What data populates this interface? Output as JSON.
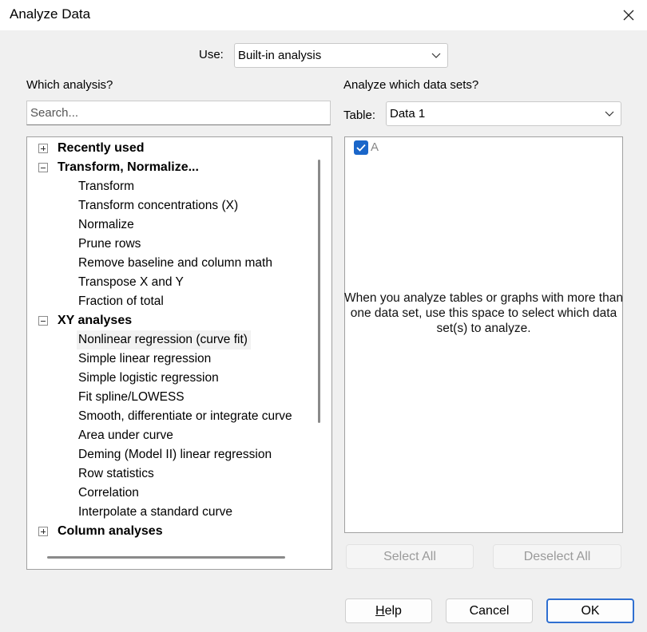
{
  "window": {
    "title": "Analyze Data"
  },
  "use": {
    "label": "Use:",
    "selected": "Built-in analysis"
  },
  "which_analysis": {
    "label": "Which analysis?",
    "search_placeholder": "Search...",
    "tree": [
      {
        "label": "Recently used",
        "expanded": false,
        "children": []
      },
      {
        "label": "Transform, Normalize...",
        "expanded": true,
        "children": [
          "Transform",
          "Transform concentrations (X)",
          "Normalize",
          "Prune rows",
          "Remove baseline and column math",
          "Transpose X and Y",
          "Fraction of total"
        ]
      },
      {
        "label": "XY analyses",
        "expanded": true,
        "children": [
          "Nonlinear regression (curve fit)",
          "Simple linear regression",
          "Simple logistic regression",
          "Fit spline/LOWESS",
          "Smooth, differentiate or integrate curve",
          "Area under curve",
          "Deming (Model II) linear regression",
          "Row statistics",
          "Correlation",
          "Interpolate a standard curve"
        ]
      },
      {
        "label": "Column analyses",
        "expanded": false,
        "children": []
      }
    ],
    "selected_item": "Nonlinear regression (curve fit)"
  },
  "datasets": {
    "label": "Analyze which data sets?",
    "table_label": "Table:",
    "table_selected": "Data 1",
    "items": [
      {
        "label": "A",
        "checked": true
      }
    ],
    "hint": "When you analyze tables or graphs with more than one data set, use this space to select which data set(s) to analyze.",
    "select_all": "Select All",
    "deselect_all": "Deselect All"
  },
  "buttons": {
    "help": "Help",
    "cancel": "Cancel",
    "ok": "OK"
  },
  "colors": {
    "accent": "#1a66c9",
    "primary_border": "#2f6fd1"
  }
}
